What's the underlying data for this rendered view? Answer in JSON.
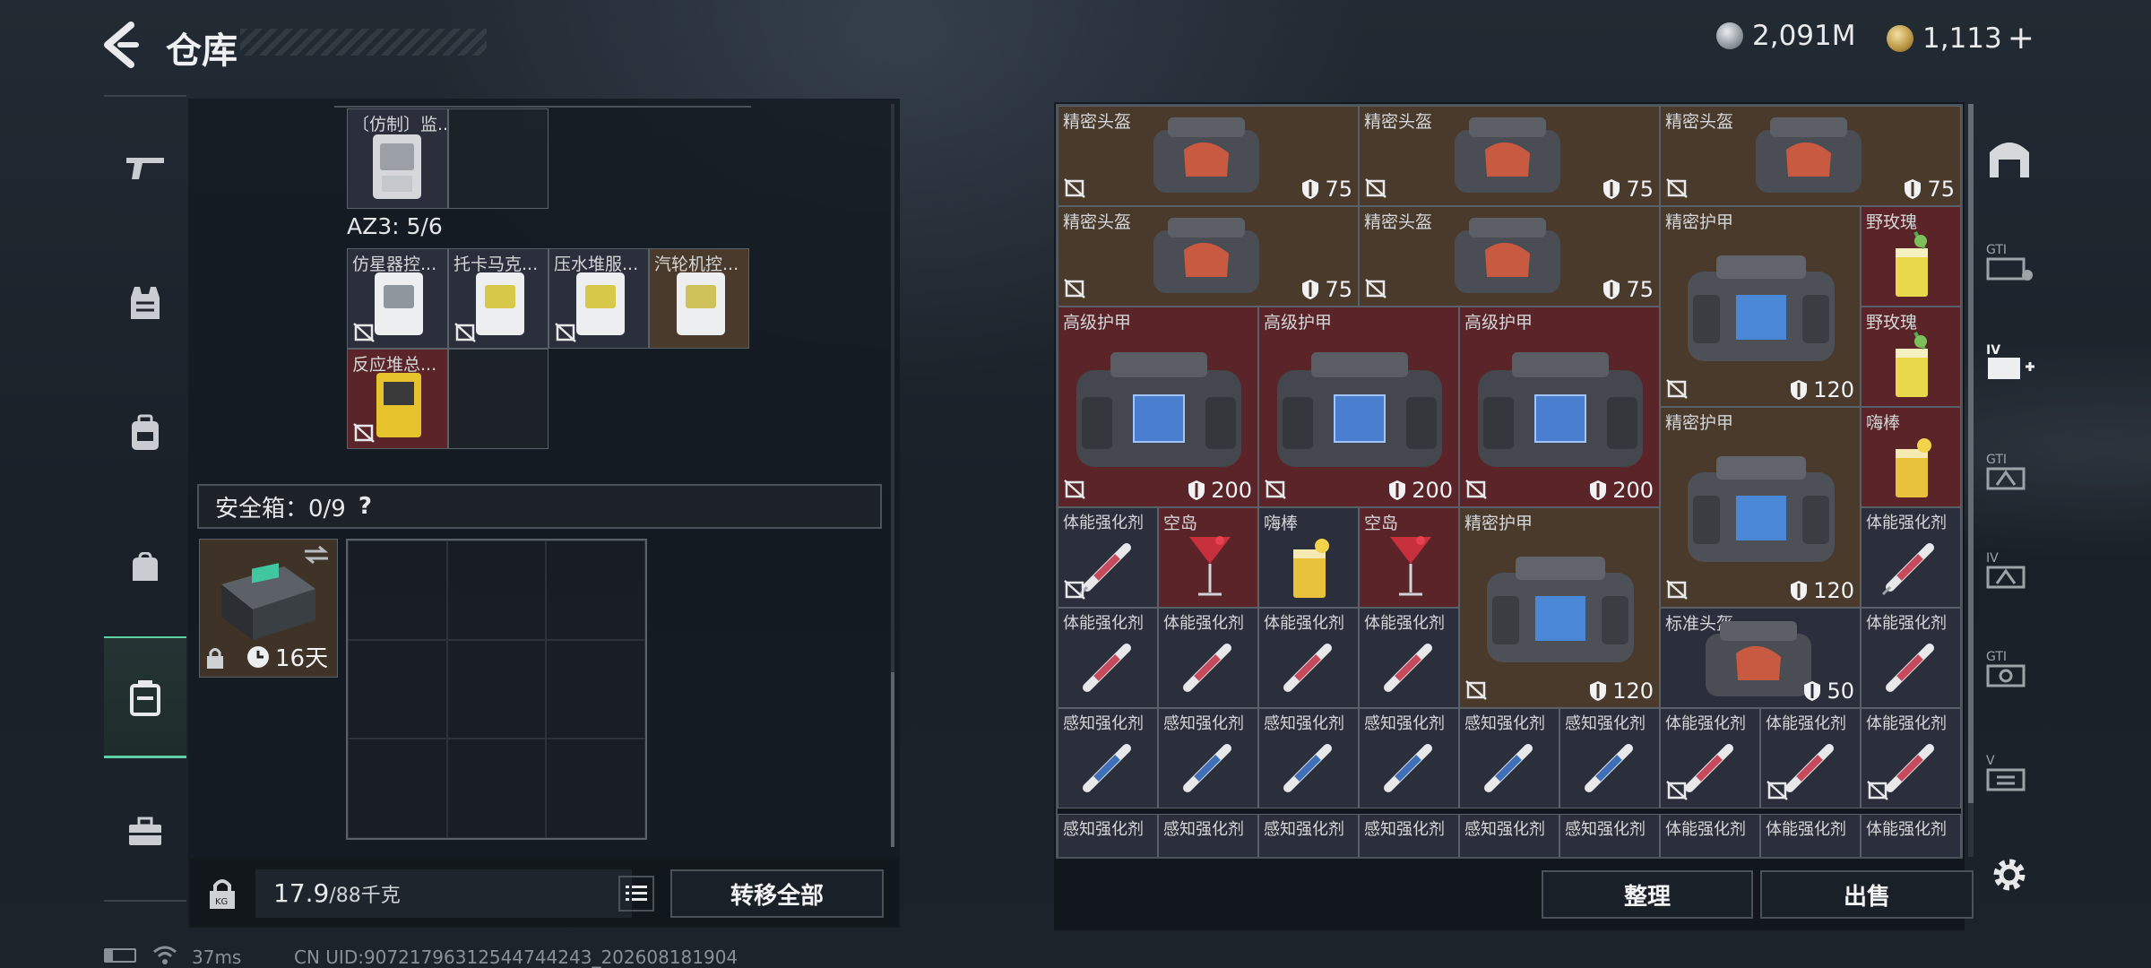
{
  "header": {
    "title": "仓库"
  },
  "currency": {
    "silver": "2,091M",
    "gold": "1,113",
    "gold_plus": "+"
  },
  "left": {
    "top_item_label": "〔仿制〕监...",
    "az3_label": "AZ3: 5/6",
    "az3_items": [
      "仿星器控...",
      "托卡马克...",
      "压水堆服...",
      "汽轮机控..."
    ],
    "reactor_item": "反应堆总...",
    "safe_box_label": "安全箱：0/9",
    "safe_box_help": "?",
    "safe_timer": "16天",
    "weight_value": "17.9",
    "weight_max": "/88千克",
    "transfer_all": "转移全部"
  },
  "right": {
    "helmet_p": "精密头盔",
    "armor_p": "精密护甲",
    "armor_h": "高级护甲",
    "helmet_s": "标准头盔",
    "rose": "野玫瑰",
    "stick": "嗨棒",
    "island": "空岛",
    "phys": "体能强化剂",
    "sense": "感知强化剂",
    "v75": "75",
    "v120": "120",
    "v200": "200",
    "v50": "50",
    "sort_button": "整理",
    "sell_button": "出售"
  },
  "footer": {
    "ping": "37ms",
    "uid": "CN UID:90721796312544744243_202608181904"
  },
  "colors": {
    "accent": "#5fd0a5",
    "brown_cell": "#4a3a2c",
    "red_cell": "#5a2428",
    "dark_cell": "#2b2f3b"
  }
}
